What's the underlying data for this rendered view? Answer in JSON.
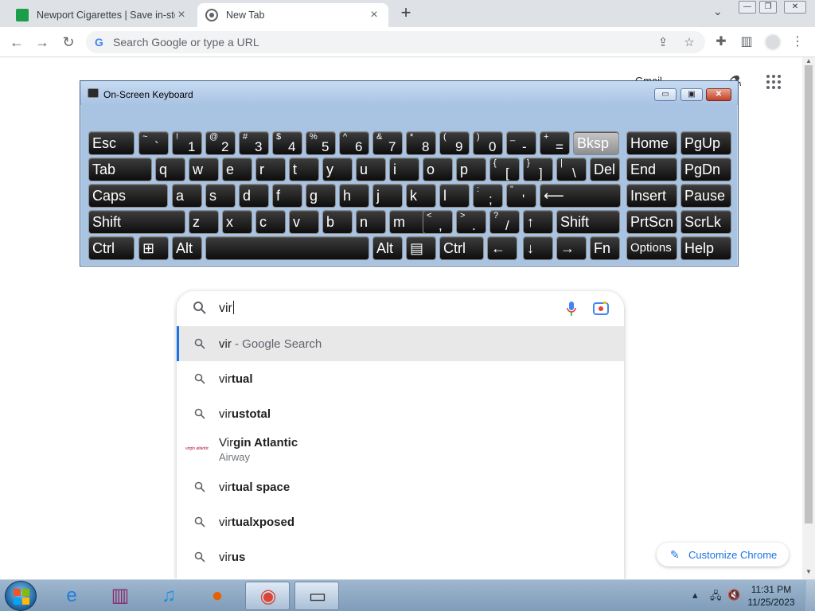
{
  "browser": {
    "tabs": [
      {
        "title": "Newport Cigarettes | Save in-sto",
        "active": false
      },
      {
        "title": "New Tab",
        "active": true
      }
    ],
    "omnibox_placeholder": "Search Google or type a URL",
    "window_controls": {
      "minimize": "—",
      "restore": "❐",
      "close": "✕"
    }
  },
  "ntp": {
    "gmail_link": "Gmail",
    "search": {
      "typed": "vir",
      "suggestions": [
        {
          "prefix": "vir",
          "rest": " - Google Search",
          "sub": ""
        },
        {
          "prefix": "vir",
          "rest": "tual",
          "sub": ""
        },
        {
          "prefix": "vir",
          "rest": "ustotal",
          "sub": ""
        },
        {
          "prefix": "Vir",
          "rest": "gin Atlantic",
          "sub": "Airway",
          "logo": "virgin atlantic"
        },
        {
          "prefix": "vir",
          "rest": "tual space",
          "sub": ""
        },
        {
          "prefix": "vir",
          "rest": "tualxposed",
          "sub": ""
        },
        {
          "prefix": "vir",
          "rest": "us",
          "sub": ""
        }
      ]
    },
    "customize_label": "Customize Chrome"
  },
  "osk": {
    "title": "On-Screen Keyboard",
    "controls": {
      "minimize": "▭",
      "restore": "▣",
      "close": "✕"
    },
    "rows": [
      [
        {
          "main": "Esc"
        },
        {
          "top": "~",
          "bot": "`"
        },
        {
          "top": "!",
          "bot": "1"
        },
        {
          "top": "@",
          "bot": "2"
        },
        {
          "top": "#",
          "bot": "3"
        },
        {
          "top": "$",
          "bot": "4"
        },
        {
          "top": "%",
          "bot": "5"
        },
        {
          "top": "^",
          "bot": "6"
        },
        {
          "top": "&",
          "bot": "7"
        },
        {
          "top": "*",
          "bot": "8"
        },
        {
          "top": "(",
          "bot": "9"
        },
        {
          "top": ")",
          "bot": "0"
        },
        {
          "top": "_",
          "bot": "-"
        },
        {
          "top": "+",
          "bot": "="
        },
        {
          "main": "Bksp",
          "pressed": true
        },
        {
          "main": "Home"
        },
        {
          "main": "PgUp"
        }
      ],
      [
        {
          "main": "Tab"
        },
        {
          "main": "q"
        },
        {
          "main": "w"
        },
        {
          "main": "e"
        },
        {
          "main": "r"
        },
        {
          "main": "t"
        },
        {
          "main": "y"
        },
        {
          "main": "u"
        },
        {
          "main": "i"
        },
        {
          "main": "o"
        },
        {
          "main": "p"
        },
        {
          "top": "{",
          "bot": "["
        },
        {
          "top": "}",
          "bot": "]"
        },
        {
          "top": "|",
          "bot": "\\"
        },
        {
          "main": "Del"
        },
        {
          "main": "End"
        },
        {
          "main": "PgDn"
        }
      ],
      [
        {
          "main": "Caps"
        },
        {
          "main": "a"
        },
        {
          "main": "s"
        },
        {
          "main": "d"
        },
        {
          "main": "f"
        },
        {
          "main": "g"
        },
        {
          "main": "h"
        },
        {
          "main": "j"
        },
        {
          "main": "k"
        },
        {
          "main": "l"
        },
        {
          "top": ":",
          "bot": ";"
        },
        {
          "top": "\"",
          "bot": "'"
        },
        {
          "main": "⟵"
        },
        {
          "main": "Insert"
        },
        {
          "main": "Pause"
        }
      ],
      [
        {
          "main": "Shift"
        },
        {
          "main": "z"
        },
        {
          "main": "x"
        },
        {
          "main": "c"
        },
        {
          "main": "v"
        },
        {
          "main": "b"
        },
        {
          "main": "n"
        },
        {
          "main": "m"
        },
        {
          "top": "<",
          "bot": ","
        },
        {
          "top": ">",
          "bot": "."
        },
        {
          "top": "?",
          "bot": "/"
        },
        {
          "main": "↑"
        },
        {
          "main": "Shift"
        },
        {
          "main": "PrtScn"
        },
        {
          "main": "ScrLk"
        }
      ],
      [
        {
          "main": "Ctrl"
        },
        {
          "main": "⊞"
        },
        {
          "main": "Alt"
        },
        {
          "main": ""
        },
        {
          "main": "Alt"
        },
        {
          "main": "▤"
        },
        {
          "main": "Ctrl"
        },
        {
          "main": "←"
        },
        {
          "main": "↓"
        },
        {
          "main": "→"
        },
        {
          "main": "Fn"
        },
        {
          "main": "Options"
        },
        {
          "main": "Help"
        }
      ]
    ]
  },
  "taskbar": {
    "apps": [
      {
        "name": "ie",
        "glyph": "e",
        "color": "#1f7fd6"
      },
      {
        "name": "winrar",
        "glyph": "▥",
        "color": "#8b2a6b"
      },
      {
        "name": "itunes",
        "glyph": "♫",
        "color": "#1c8fe0"
      },
      {
        "name": "firefox",
        "glyph": "●",
        "color": "#e66000"
      },
      {
        "name": "chrome",
        "glyph": "◉",
        "color": "#db4437",
        "active": true
      },
      {
        "name": "on-screen-keyboard",
        "glyph": "▭",
        "color": "#333333",
        "active": true
      }
    ],
    "clock_time": "11:31 PM",
    "clock_date": "11/25/2023"
  }
}
